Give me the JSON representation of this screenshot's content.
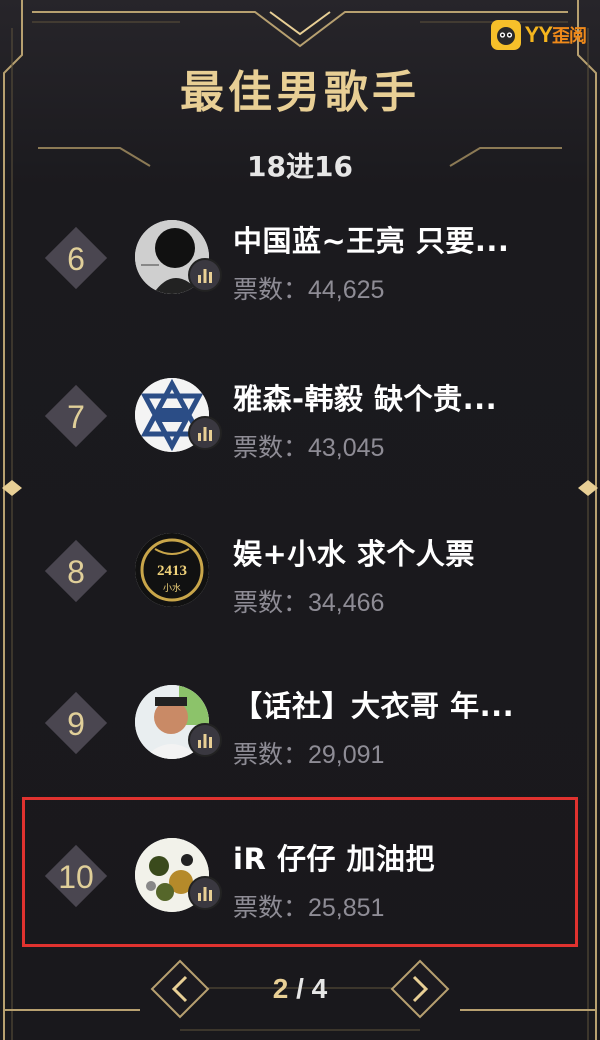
{
  "window": {
    "title": "最佳男歌手",
    "round": "18进16",
    "watermark": {
      "brand": "YY",
      "suffix": "歪阅"
    }
  },
  "colors": {
    "gold": "#e8cf95",
    "frame": "#c8b27a",
    "highlight": "#e0322f",
    "background": "#1c1a1f"
  },
  "entries": [
    {
      "rank": "6",
      "name": "中国蓝~王亮 只要...",
      "votes": "票数：44,625",
      "avatar_icon": "avatar-dark-silhouette"
    },
    {
      "rank": "7",
      "name": "雅森-韩毅 缺个贵...",
      "votes": "票数：43,045",
      "avatar_icon": "avatar-star-logo"
    },
    {
      "rank": "8",
      "name": "娱+小水 求个人票",
      "votes": "票数：34,466",
      "avatar_icon": "avatar-2413-badge",
      "badge_text": "2413",
      "badge_sub": "小水"
    },
    {
      "rank": "9",
      "name": "【话社】大衣哥 年...",
      "votes": "票数：29,091",
      "avatar_icon": "avatar-photo-man"
    },
    {
      "rank": "10",
      "name": "iR 仔仔 加油把",
      "votes": "票数：25,851",
      "avatar_icon": "avatar-floral",
      "highlighted": true
    }
  ],
  "pager": {
    "current": "2",
    "separator": " / ",
    "total": "4"
  }
}
